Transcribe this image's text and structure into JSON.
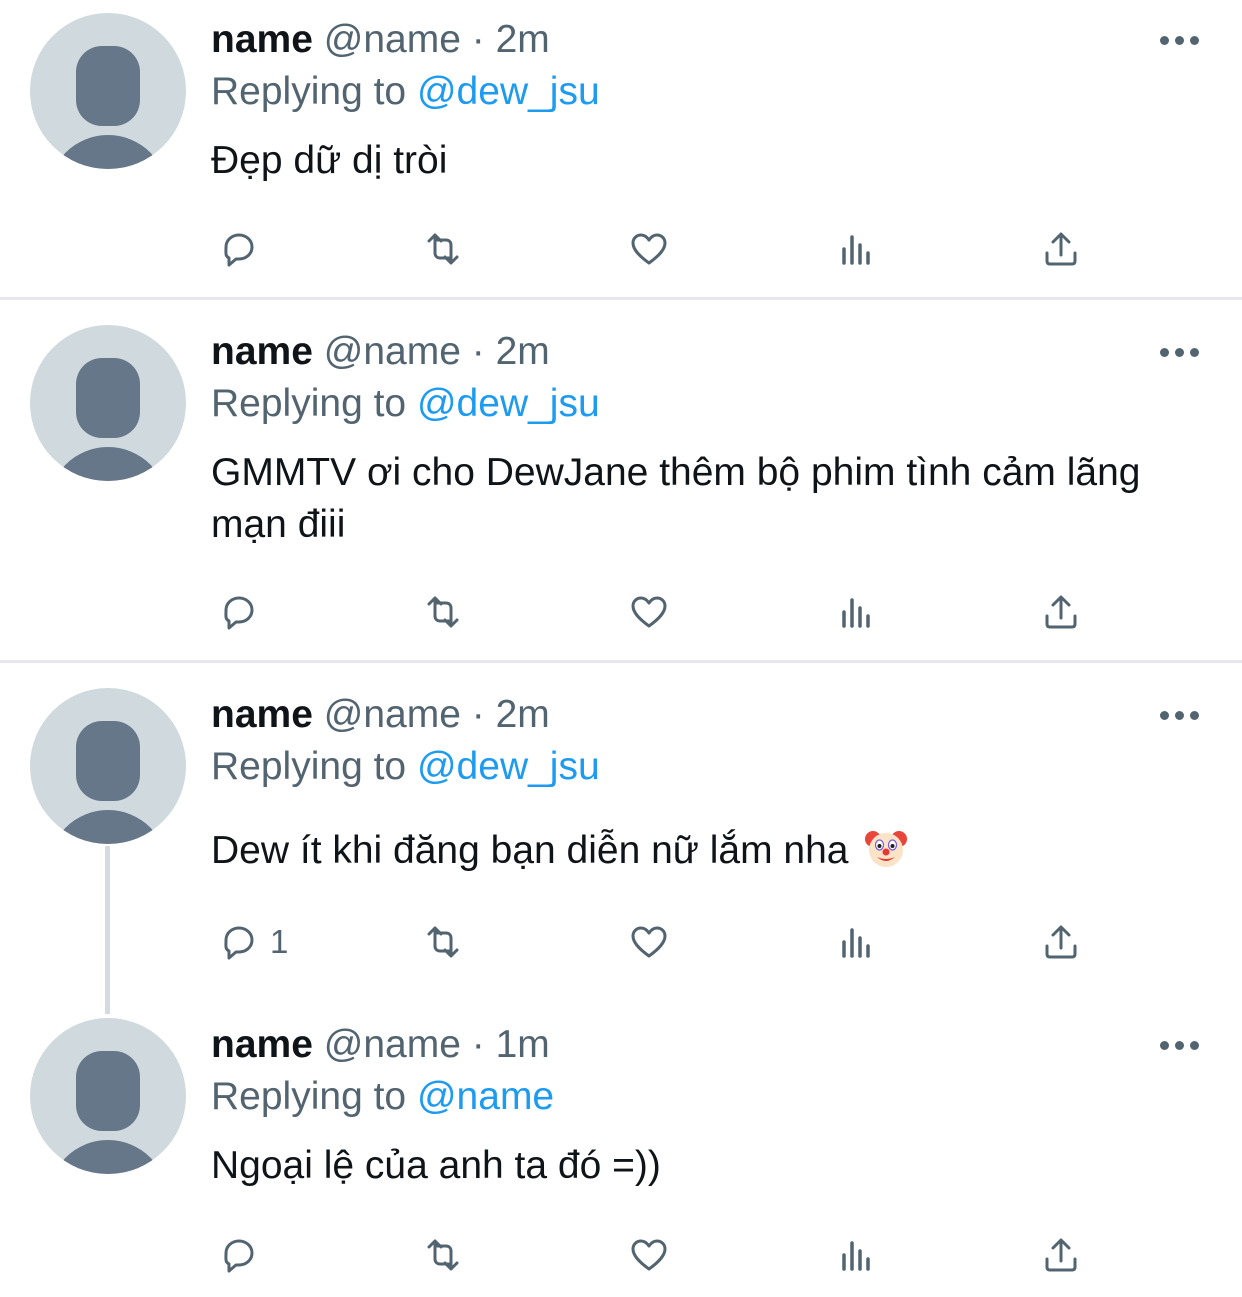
{
  "tweets": [
    {
      "name": "name",
      "handle": "@name",
      "separator": "·",
      "time": "2m",
      "replying_prefix": "Replying to",
      "replying_to": "@dew_jsu",
      "text": "Đẹp dữ dị tròi",
      "reply_count": ""
    },
    {
      "name": "name",
      "handle": "@name",
      "separator": "·",
      "time": "2m",
      "replying_prefix": "Replying to",
      "replying_to": "@dew_jsu",
      "text": "GMMTV ơi cho DewJane thêm bộ phim tình cảm lãng mạn điii",
      "reply_count": ""
    },
    {
      "name": "name",
      "handle": "@name",
      "separator": "·",
      "time": "2m",
      "replying_prefix": "Replying to",
      "replying_to": "@dew_jsu",
      "text": "Dew ít khi đăng bạn diễn nữ lắm nha",
      "emoji": "clown-face-emoji",
      "reply_count": "1"
    },
    {
      "name": "name",
      "handle": "@name",
      "separator": "·",
      "time": "1m",
      "replying_prefix": "Replying to",
      "replying_to": "@name",
      "text": "Ngoại lệ của anh ta đó =))",
      "reply_count": ""
    }
  ],
  "icons": {
    "reply": "reply-icon",
    "retweet": "retweet-icon",
    "like": "like-heart-icon",
    "views": "views-bar-chart-icon",
    "share": "share-upload-icon",
    "more": "more-options-icon"
  },
  "colors": {
    "text": "#0f1419",
    "secondary": "#536471",
    "accent": "#1d9bf0",
    "avatar_bg": "#cfd9de",
    "avatar_fg": "#66778a",
    "divider": "#e6e9eb"
  }
}
